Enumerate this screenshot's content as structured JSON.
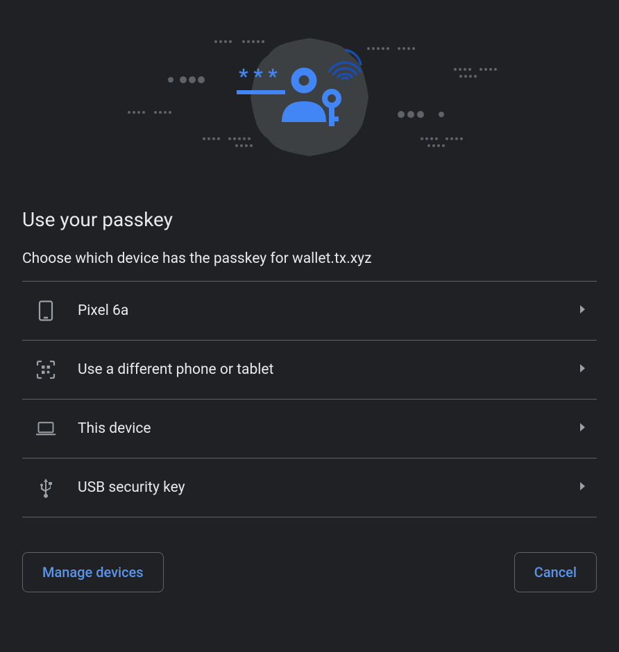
{
  "title": "Use your passkey",
  "subtitle": "Choose which device has the passkey for wallet.tx.xyz",
  "devices": [
    {
      "label": "Pixel 6a"
    },
    {
      "label": "Use a different phone or tablet"
    },
    {
      "label": "This device"
    },
    {
      "label": "USB security key"
    }
  ],
  "buttons": {
    "manage": "Manage devices",
    "cancel": "Cancel"
  },
  "colors": {
    "accent": "#4680e8",
    "link": "#5b95eb",
    "muted": "#9aa0a6",
    "bg": "#202124"
  }
}
